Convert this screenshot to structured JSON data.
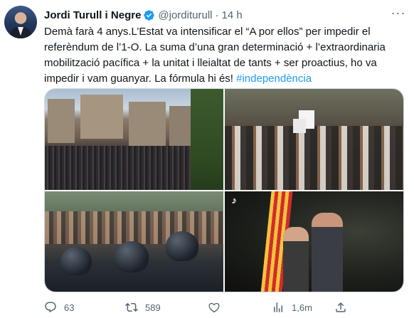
{
  "tweet": {
    "author": {
      "display_name": "Jordi Turull i Negre",
      "handle": "@jorditurull",
      "separator": "·",
      "time": "14 h"
    },
    "text_parts": [
      "Demà farà 4 anys.L’Estat va intensificar el “A por ellos” per impedir el referèndum de l’1-O. La suma d’una gran determinació + l’extraordinaria mobilització pacífica + la unitat i lleialtat de tants + ser proactius, ho va impedir i vam guanyar. La fórmula hi és! "
    ],
    "hashtag": "#independència",
    "more_icon": "···",
    "tiktok_icon": "♪",
    "actions": {
      "reply_count": "63",
      "retweet_count": "589",
      "like_count": "",
      "views_count": "1,6m",
      "share_label": ""
    }
  },
  "colors": {
    "text": "#0f1419",
    "secondary": "#536471",
    "link": "#1d9bf0",
    "border": "#cfd9de",
    "verified": "#1d9bf0"
  },
  "icons": [
    "verified-badge-icon",
    "more-icon",
    "reply-icon",
    "retweet-icon",
    "like-icon",
    "views-icon",
    "share-icon",
    "tiktok-icon"
  ]
}
